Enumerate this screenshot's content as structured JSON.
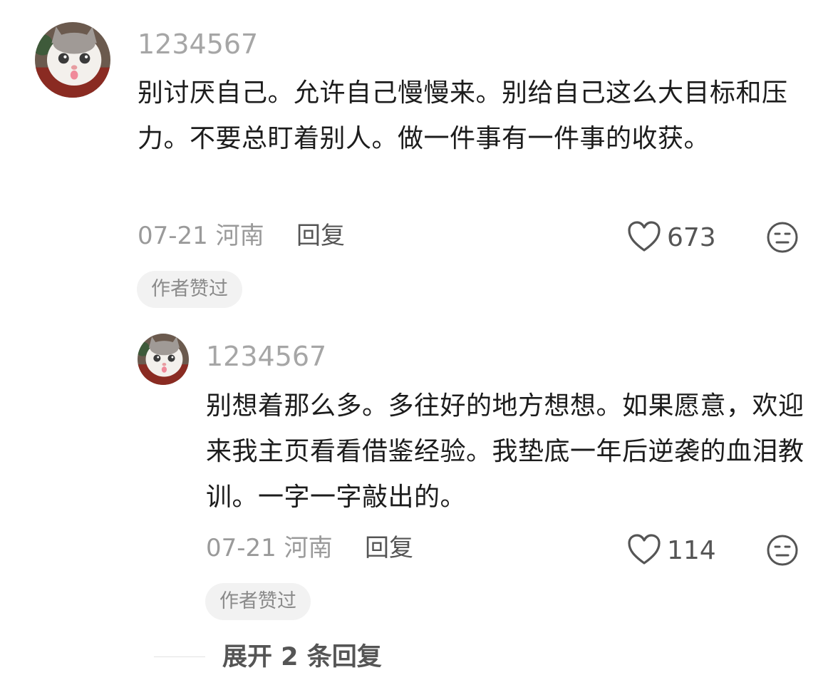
{
  "comments": [
    {
      "username": "1234567",
      "text": "别讨厌自己。允许自己慢慢来。别给自己这么大目标和压力。不要总盯着别人。做一件事有一件事的收获。",
      "date": "07-21",
      "location": "河南",
      "reply_label": "回复",
      "likes": "673",
      "badge": "作者赞过"
    },
    {
      "username": "1234567",
      "text": "别想着那么多。多往好的地方想想。如果愿意，欢迎来我主页看看借鉴经验。我垫底一年后逆袭的血泪教训。一字一字敲出的。",
      "date": "07-21",
      "location": "河南",
      "reply_label": "回复",
      "likes": "114",
      "badge": "作者赞过"
    }
  ],
  "expand": {
    "label": "展开 2 条回复"
  },
  "icons": {
    "like": "heart-outline-icon",
    "dislike": "neutral-face-icon"
  },
  "colors": {
    "username": "#a6a6a6",
    "badge_bg": "#f2f2f2",
    "text": "#1c1c1c"
  }
}
